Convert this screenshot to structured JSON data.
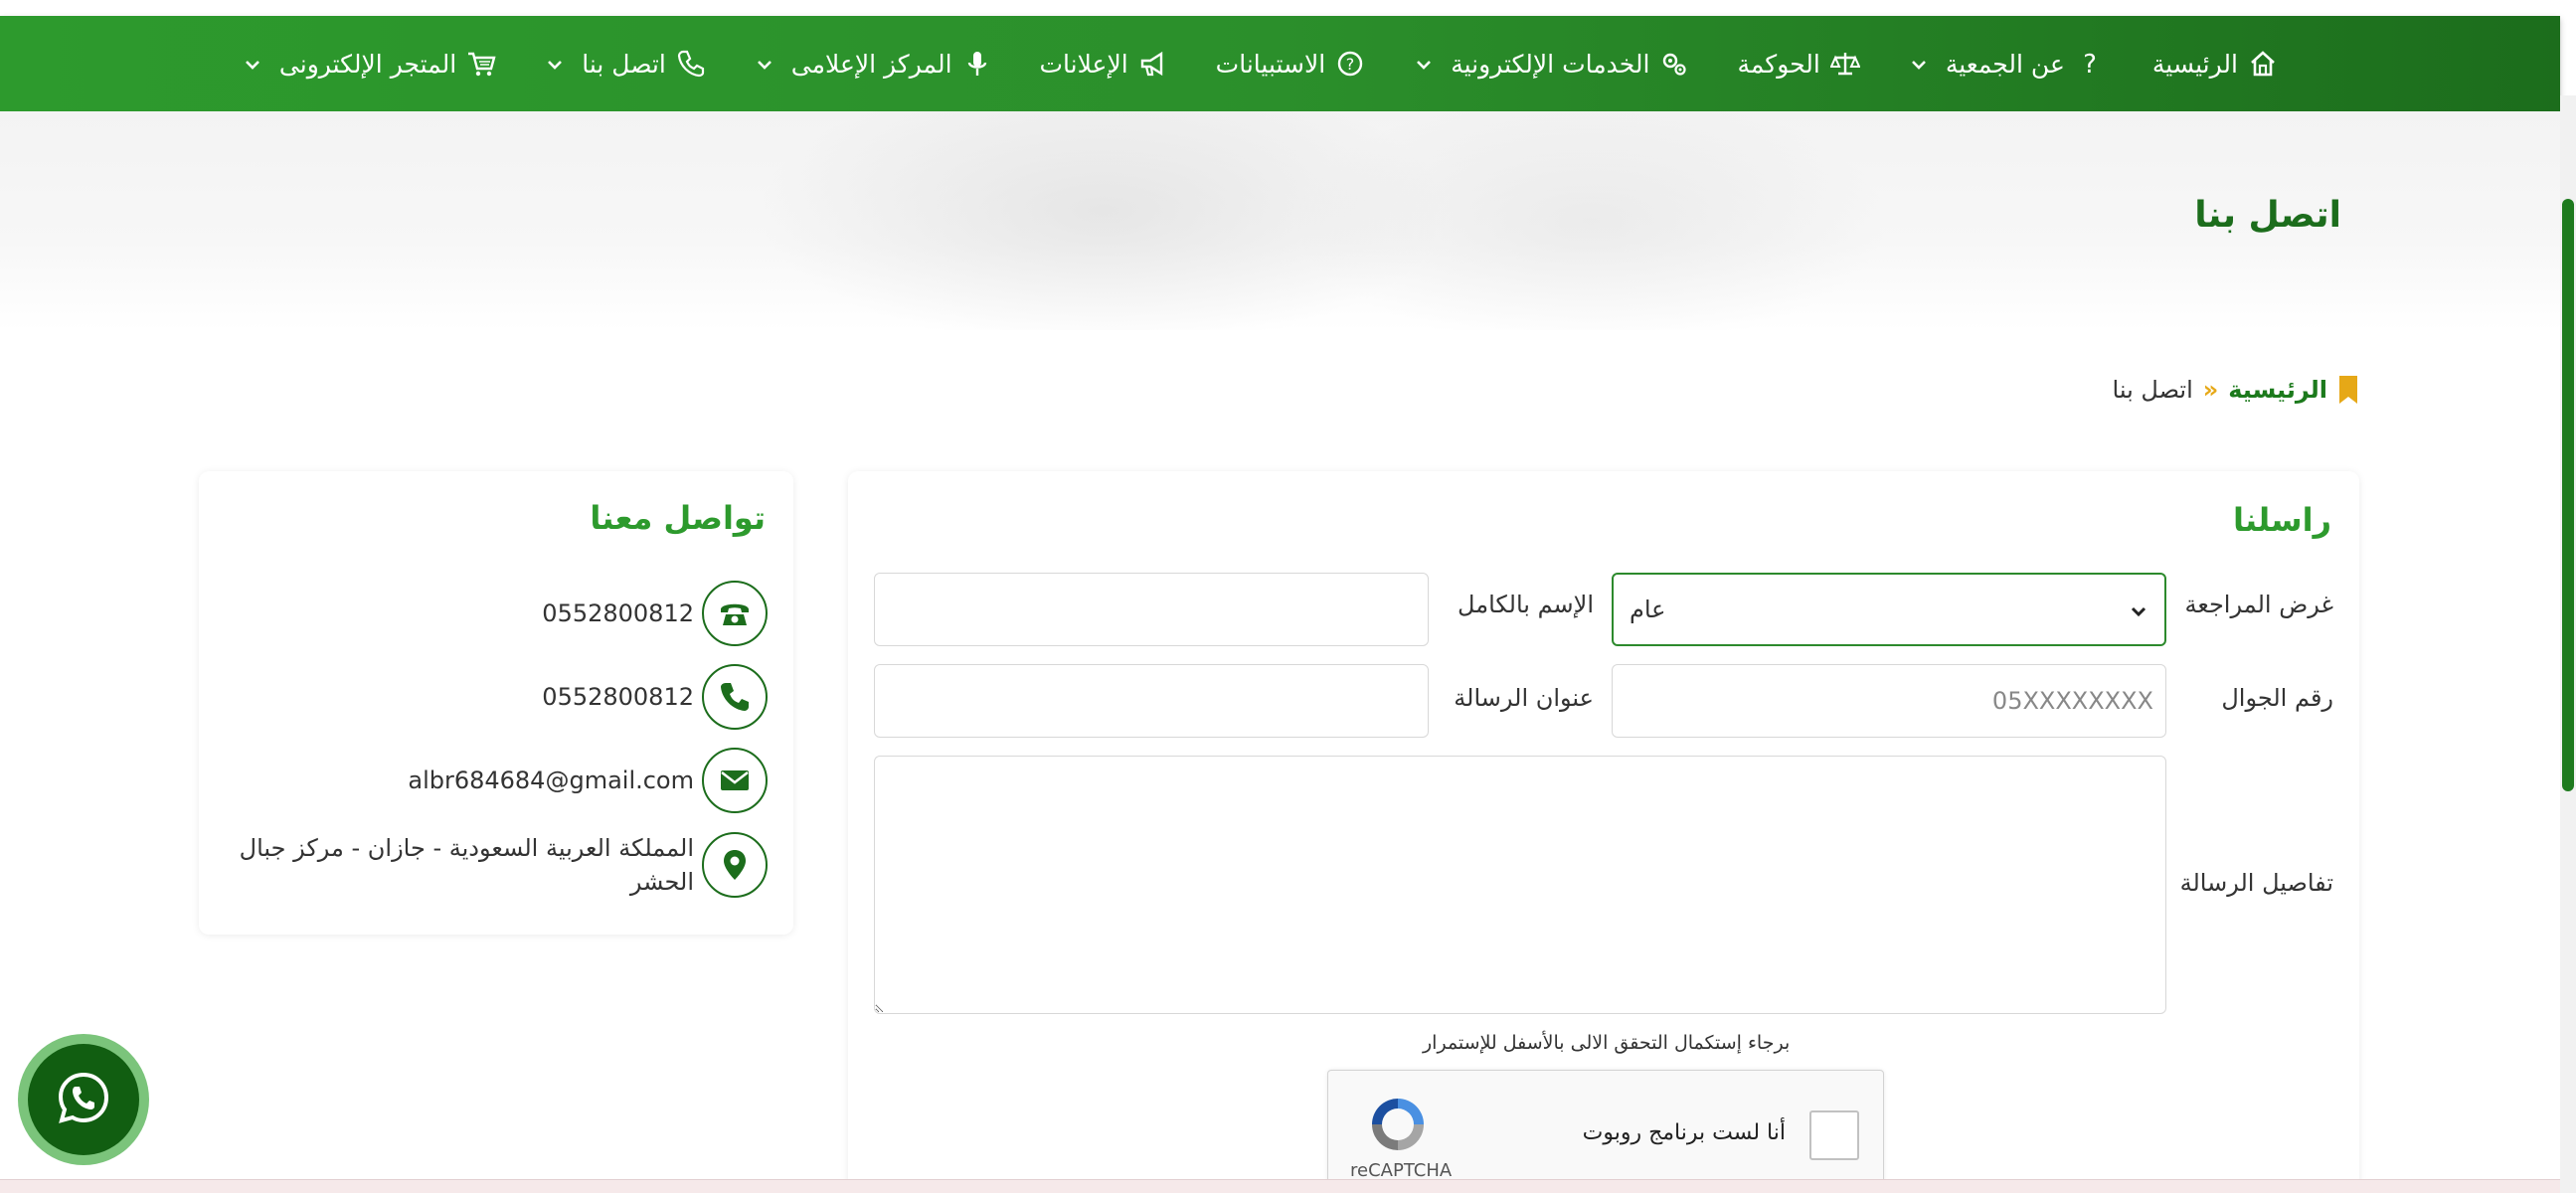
{
  "nav": {
    "items": [
      {
        "label": "الرئيسية",
        "icon": "home-icon",
        "dropdown": false
      },
      {
        "label": "عن الجمعية",
        "icon": "question-icon",
        "dropdown": true
      },
      {
        "label": "الحوكمة",
        "icon": "scale-icon",
        "dropdown": false
      },
      {
        "label": "الخدمات الإلكترونية",
        "icon": "cogs-icon",
        "dropdown": true
      },
      {
        "label": "الاستبيانات",
        "icon": "question-circle-icon",
        "dropdown": false
      },
      {
        "label": "الإعلانات",
        "icon": "megaphone-icon",
        "dropdown": false
      },
      {
        "label": "المركز الإعلامى",
        "icon": "microphone-icon",
        "dropdown": true
      },
      {
        "label": "اتصل بنا",
        "icon": "phone-icon",
        "dropdown": true
      },
      {
        "label": "المتجر الإلكترونى",
        "icon": "cart-icon",
        "dropdown": true
      }
    ]
  },
  "hero": {
    "title": "اتصل بنا"
  },
  "breadcrumb": {
    "home": "الرئيسية",
    "separator": "»",
    "current": "اتصل بنا"
  },
  "form": {
    "title": "راسلنا",
    "purpose_label": "غرض المراجعة",
    "purpose_value": "عام",
    "name_label": "الإسم بالكامل",
    "name_value": "",
    "mobile_label": "رقم الجوال",
    "mobile_placeholder": "05XXXXXXXX",
    "subject_label": "عنوان الرسالة",
    "subject_value": "",
    "details_label": "تفاصيل الرسالة",
    "details_value": "",
    "captcha_hint": "برجاء إستكمال التحقق الالى بالأسفل للإستمرار",
    "captcha_label": "أنا لست برنامج روبوت",
    "captcha_brand": "reCAPTCHA"
  },
  "contact": {
    "title": "تواصل معنا",
    "phone": "0552800812",
    "mobile": "0552800812",
    "email": "albr684684@gmail.com",
    "address": "المملكة العربية السعودية - جازان - مركز جبال الحشر"
  },
  "colors": {
    "primary": "#2d9a2d",
    "dark": "#1c6d1c",
    "accent": "#e6a817"
  }
}
